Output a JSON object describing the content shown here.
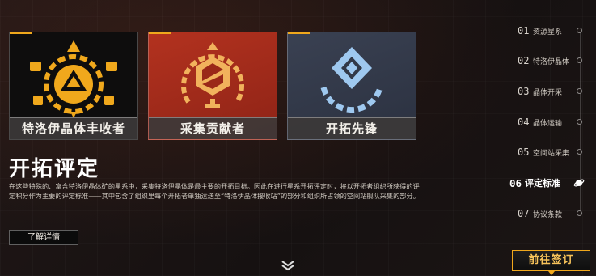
{
  "cards": [
    {
      "label": "特洛伊晶体丰收者",
      "color": "#f0a81c"
    },
    {
      "label": "采集贡献者",
      "color": "#f1b25c"
    },
    {
      "label": "开拓先锋",
      "color": "#9ec8ef"
    }
  ],
  "section": {
    "title": "开拓评定",
    "description": "在这些特殊的、富含特洛伊晶体矿的星系中，采集特洛伊晶体是最主要的开拓目标。因此在进行星系开拓评定时，将以开拓者组织所获得的评定积分作为主要的评定标准——其中包含了组织里每个开拓者单独运送至“特洛伊晶体接收站”的部分和组织所占领的空间站舰队采集的部分。",
    "more_button": "了解详情"
  },
  "nav": [
    {
      "num": "01",
      "label": "资源星系"
    },
    {
      "num": "02",
      "label": "特洛伊晶体"
    },
    {
      "num": "03",
      "label": "晶体开采"
    },
    {
      "num": "04",
      "label": "晶体运输"
    },
    {
      "num": "05",
      "label": "空间站采集"
    },
    {
      "num": "06",
      "label": "评定标准"
    },
    {
      "num": "07",
      "label": "协议条款"
    }
  ],
  "active_nav_index": 5,
  "sign_button": "前往签订",
  "accent_color": "#f0a81c",
  "icons": {
    "card1": "crystal-harvester-emblem-icon",
    "card2": "gear-crystal-emblem-icon",
    "card3": "diamond-gear-emblem-icon",
    "scroll": "double-chevron-down-icon",
    "nav_active": "planet-orbit-icon"
  }
}
